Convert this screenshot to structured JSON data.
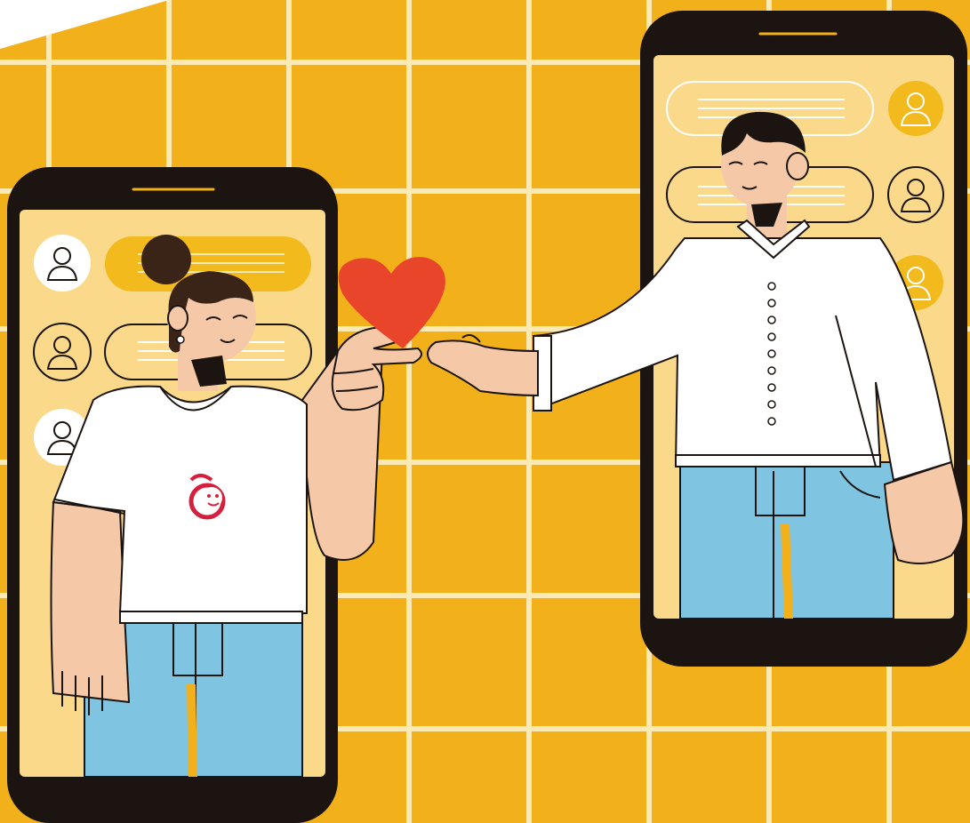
{
  "palette": {
    "background": "#F2B01B",
    "grid_lines": "#FCE9B4",
    "phone_body": "#1B1410",
    "screen": "#FBD98A",
    "bubble_filled": "#F2BA1C",
    "heart": "#E8452A",
    "skin": "#F5C9A8",
    "shirt": "#FFFFFF",
    "jeans": "#7FC4E0",
    "hair": "#3A2418",
    "logo": "#D61F3C"
  },
  "icons": [
    "left-phone",
    "right-phone",
    "user-avatar-icon",
    "chat-bubble",
    "heart-icon",
    "shirt-logo"
  ],
  "left_phone": {
    "chat_rows": [
      {
        "avatar_style": "white",
        "bubble_style": "filled"
      },
      {
        "avatar_style": "outline",
        "bubble_style": "outline"
      },
      {
        "avatar_style": "white",
        "bubble_style": "none"
      }
    ]
  },
  "right_phone": {
    "chat_rows": [
      {
        "avatar_style": "filled",
        "bubble_style": "outline"
      },
      {
        "avatar_style": "outline",
        "bubble_style": "outline"
      },
      {
        "avatar_style": "filled",
        "bubble_style": "none"
      }
    ]
  }
}
